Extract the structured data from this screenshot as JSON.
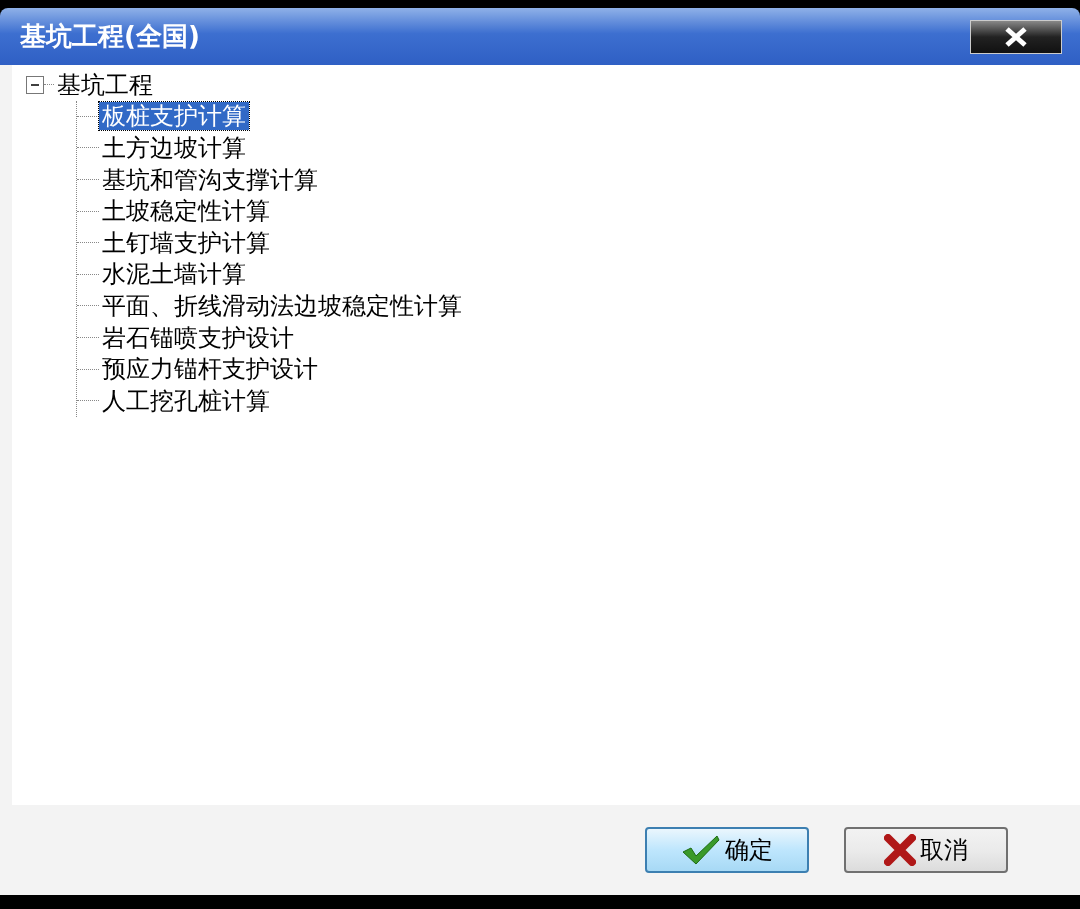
{
  "window": {
    "title": "基坑工程(全国)"
  },
  "tree": [
    {
      "label": "基坑工程",
      "expanded": true,
      "selected": false,
      "children": [
        {
          "label": "板桩支护计算",
          "selected": true
        },
        {
          "label": "土方边坡计算",
          "selected": false
        },
        {
          "label": "基坑和管沟支撑计算",
          "selected": false
        },
        {
          "label": "土坡稳定性计算",
          "selected": false
        },
        {
          "label": "土钉墙支护计算",
          "selected": false
        },
        {
          "label": "水泥土墙计算",
          "selected": false
        },
        {
          "label": "平面、折线滑动法边坡稳定性计算",
          "selected": false
        },
        {
          "label": "岩石锚喷支护设计",
          "selected": false
        },
        {
          "label": "预应力锚杆支护设计",
          "selected": false
        },
        {
          "label": "人工挖孔桩计算",
          "selected": false
        }
      ]
    }
  ],
  "buttons": [
    {
      "label": "确定",
      "kind": "ok"
    },
    {
      "label": "取消",
      "kind": "cancel"
    }
  ]
}
